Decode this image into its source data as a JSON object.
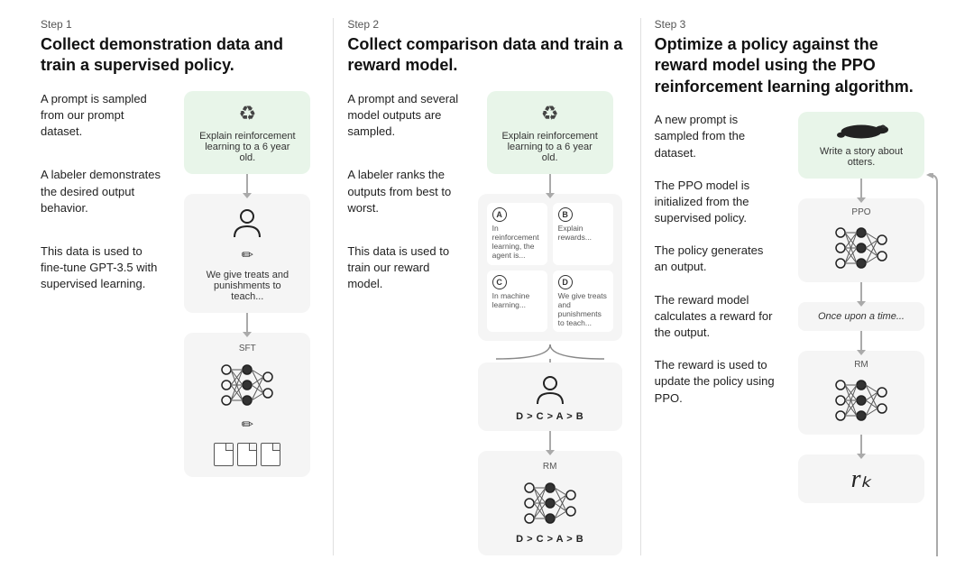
{
  "steps": [
    {
      "id": "step1",
      "label": "Step 1",
      "title": "Collect demonstration data and train a supervised policy.",
      "text_blocks": [
        "A prompt is sampled from our prompt dataset.",
        "A labeler demonstrates the desired output behavior.",
        "This data is used to fine-tune GPT-3.5 with supervised learning."
      ],
      "prompt_text": "Explain reinforcement learning to a 6 year old.",
      "output_text": "We give treats and punishments to teach...",
      "sft_label": "SFT"
    },
    {
      "id": "step2",
      "label": "Step 2",
      "title": "Collect comparison data and train a reward model.",
      "text_blocks": [
        "A prompt and several model outputs are sampled.",
        "A labeler ranks the outputs from best to worst.",
        "This data is used to train our reward model."
      ],
      "prompt_text": "Explain reinforcement learning to a 6 year old.",
      "choices": [
        {
          "letter": "A",
          "text": "In reinforcement learning, the agent is..."
        },
        {
          "letter": "B",
          "text": "Explain rewards..."
        },
        {
          "letter": "C",
          "text": "In machine learning..."
        },
        {
          "letter": "D",
          "text": "We give treats and punishments to teach..."
        }
      ],
      "ranking_top": "D > C > A > B",
      "rm_label": "RM",
      "ranking_bottom": "D > C > A > B"
    },
    {
      "id": "step3",
      "label": "Step 3",
      "title": "Optimize a policy against the reward model using the PPO reinforcement learning algorithm.",
      "text_blocks": [
        "A new prompt is sampled from the dataset.",
        "The PPO model is initialized from the supervised policy.",
        "The policy generates an output.",
        "The reward model calculates a reward for the output.",
        "The reward is used to update the policy using PPO."
      ],
      "prompt_text": "Write a story about otters.",
      "ppo_label": "PPO",
      "output_text": "Once upon a time...",
      "rm_label": "RM",
      "reward_value": "rₖ"
    }
  ]
}
